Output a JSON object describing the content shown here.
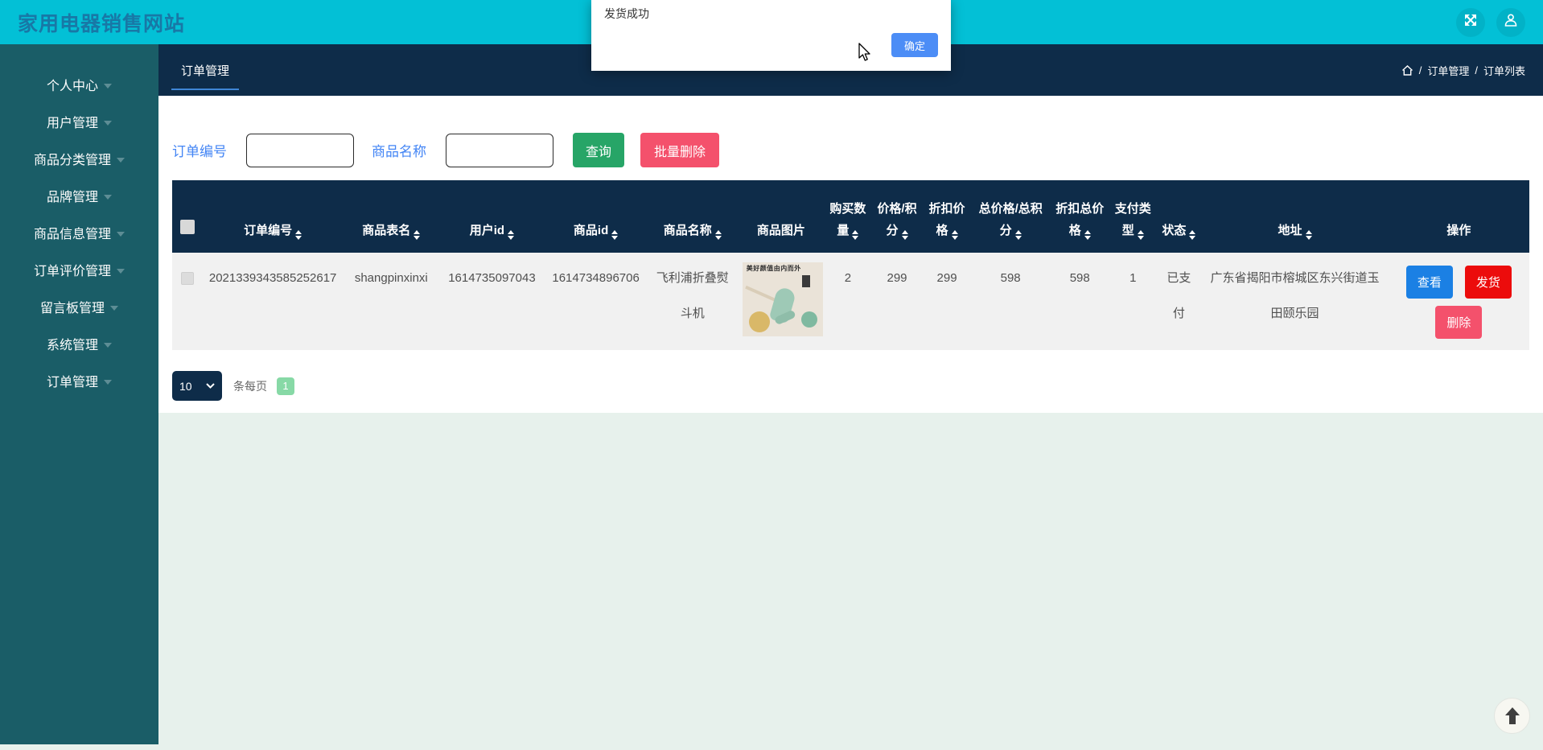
{
  "header": {
    "title": "家用电器销售网站"
  },
  "modal": {
    "message": "发货成功",
    "confirm_label": "确定"
  },
  "sidebar": {
    "items": [
      {
        "label": "个人中心"
      },
      {
        "label": "用户管理"
      },
      {
        "label": "商品分类管理"
      },
      {
        "label": "品牌管理"
      },
      {
        "label": "商品信息管理"
      },
      {
        "label": "订单评价管理"
      },
      {
        "label": "留言板管理"
      },
      {
        "label": "系统管理"
      },
      {
        "label": "订单管理"
      }
    ]
  },
  "tabbar": {
    "active_tab": "订单管理",
    "separator": "/",
    "breadcrumb": [
      "订单管理",
      "订单列表"
    ]
  },
  "search": {
    "order_no_label": "订单编号",
    "product_name_label": "商品名称",
    "query_label": "查询",
    "batch_delete_label": "批量删除"
  },
  "table": {
    "columns": [
      {
        "label": "",
        "sortable": false
      },
      {
        "label": "订单编号",
        "sortable": true
      },
      {
        "label": "商品表名",
        "sortable": true
      },
      {
        "label": "用户id",
        "sortable": true
      },
      {
        "label": "商品id",
        "sortable": true
      },
      {
        "label": "商品名称",
        "sortable": true
      },
      {
        "label": "商品图片",
        "sortable": false
      },
      {
        "label": "购买数量",
        "sortable": true
      },
      {
        "label": "价格/积分",
        "sortable": true
      },
      {
        "label": "折扣价格",
        "sortable": true
      },
      {
        "label": "总价格/总积分",
        "sortable": true
      },
      {
        "label": "折扣总价格",
        "sortable": true
      },
      {
        "label": "支付类型",
        "sortable": true
      },
      {
        "label": "状态",
        "sortable": true
      },
      {
        "label": "地址",
        "sortable": true
      },
      {
        "label": "操作",
        "sortable": false
      }
    ],
    "rows": [
      {
        "order_no": "2021339343585252617",
        "product_table": "shangpinxinxi",
        "user_id": "1614735097043",
        "product_id": "1614734896706",
        "product_name": "飞利浦折叠熨斗机",
        "product_image_caption": "美好颜值由内而外",
        "quantity": "2",
        "price": "299",
        "discount_price": "299",
        "total_price": "598",
        "discount_total_price": "598",
        "pay_type": "1",
        "status": "已支付",
        "address": "广东省揭阳市榕城区东兴街道玉田颐乐园",
        "actions": {
          "view": "查看",
          "ship": "发货",
          "delete": "删除"
        }
      }
    ]
  },
  "pagination": {
    "page_size": "10",
    "per_page_label": "条每页",
    "current_page": "1"
  },
  "icons": {
    "fullscreen_icon": "diagonal-expand-arrows",
    "user_icon": "person-silhouette",
    "home_icon": "house-outline",
    "sort_icon": "up-down-triangles",
    "caret_down_icon": "triangle-down",
    "select_chevron_icon": "chevron-down",
    "back_to_top_icon": "arrow-up",
    "cursor_icon": "mouse-pointer"
  },
  "colors": {
    "header_bg": "#03c0d6",
    "title_text": "#1878a6",
    "sidebar_bg": "#1a5d67",
    "navbar_bg": "#0e2c49",
    "page_bg": "#e7f1ec",
    "label_blue": "#4385f5",
    "query_green": "#27a567",
    "pink_red": "#f4516c",
    "ship_red": "#ec0c0c",
    "view_blue": "#1b80e4",
    "confirm_blue": "#4c8df6",
    "badge_green": "#87d9a6"
  }
}
